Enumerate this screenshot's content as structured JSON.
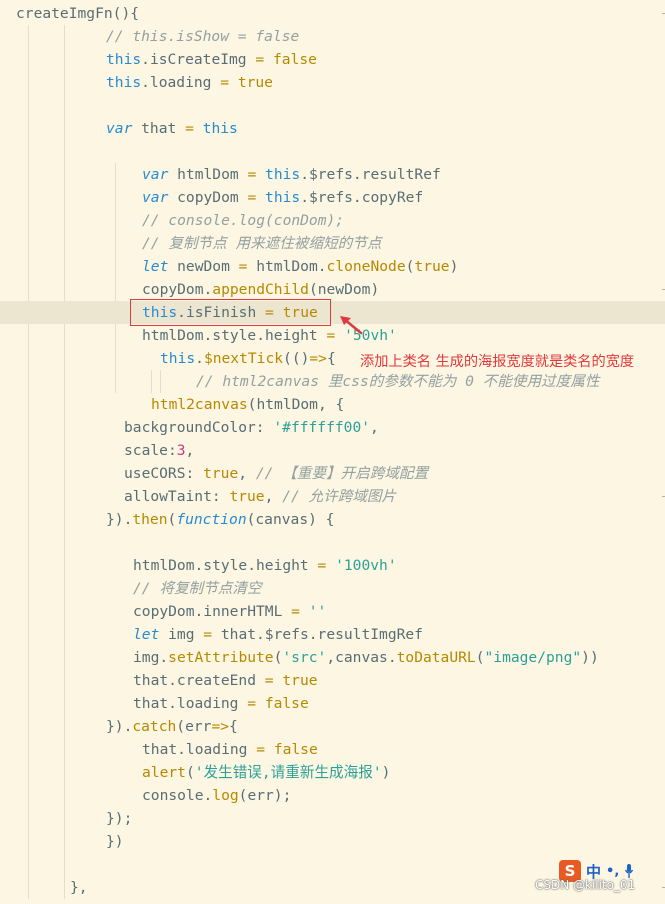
{
  "code_lines": [
    {
      "indent": 16,
      "tokens": [
        [
          "createImgFn",
          "def"
        ],
        [
          "(){",
          "def"
        ]
      ]
    },
    {
      "indent": 106,
      "tokens": [
        [
          "// this.isShow = false",
          "comment"
        ]
      ]
    },
    {
      "indent": 106,
      "tokens": [
        [
          "this",
          "kw"
        ],
        [
          ".isCreateImg ",
          "def"
        ],
        [
          "=",
          "eq"
        ],
        [
          " ",
          "def"
        ],
        [
          "false",
          "bool"
        ]
      ]
    },
    {
      "indent": 106,
      "tokens": [
        [
          "this",
          "kw"
        ],
        [
          ".loading ",
          "def"
        ],
        [
          "=",
          "eq"
        ],
        [
          " ",
          "def"
        ],
        [
          "true",
          "bool"
        ]
      ]
    },
    {
      "indent": 106,
      "tokens": []
    },
    {
      "indent": 106,
      "tokens": [
        [
          "var",
          "kwi"
        ],
        [
          " that ",
          "def"
        ],
        [
          "=",
          "eq"
        ],
        [
          " ",
          "def"
        ],
        [
          "this",
          "kw"
        ]
      ]
    },
    {
      "indent": 106,
      "tokens": []
    },
    {
      "indent": 142,
      "tokens": [
        [
          "var",
          "kwi"
        ],
        [
          " htmlDom ",
          "def"
        ],
        [
          "=",
          "eq"
        ],
        [
          " ",
          "def"
        ],
        [
          "this",
          "kw"
        ],
        [
          ".$refs.resultRef",
          "def"
        ]
      ]
    },
    {
      "indent": 142,
      "tokens": [
        [
          "var",
          "kwi"
        ],
        [
          " copyDom ",
          "def"
        ],
        [
          "=",
          "eq"
        ],
        [
          " ",
          "def"
        ],
        [
          "this",
          "kw"
        ],
        [
          ".$refs.copyRef",
          "def"
        ]
      ]
    },
    {
      "indent": 142,
      "tokens": [
        [
          "// console.log(conDom);",
          "comment"
        ]
      ]
    },
    {
      "indent": 142,
      "tokens": [
        [
          "// 复制节点 用来遮住被缩短的节点",
          "comment"
        ]
      ]
    },
    {
      "indent": 142,
      "tokens": [
        [
          "let",
          "kwi"
        ],
        [
          " newDom ",
          "def"
        ],
        [
          "=",
          "eq"
        ],
        [
          " htmlDom.",
          "def"
        ],
        [
          "cloneNode",
          "fn"
        ],
        [
          "(",
          "def"
        ],
        [
          "true",
          "bool"
        ],
        [
          ")",
          "def"
        ]
      ]
    },
    {
      "indent": 142,
      "tokens": [
        [
          "copyDom.",
          "def"
        ],
        [
          "appendChild",
          "fn"
        ],
        [
          "(newDom)",
          "def"
        ]
      ]
    },
    {
      "indent": 142,
      "tokens": [
        [
          "this",
          "kw"
        ],
        [
          ".isFinish ",
          "def"
        ],
        [
          "=",
          "eq"
        ],
        [
          " ",
          "def"
        ],
        [
          "true",
          "bool"
        ]
      ]
    },
    {
      "indent": 142,
      "tokens": [
        [
          "htmlDom.style.height ",
          "def"
        ],
        [
          "=",
          "eq"
        ],
        [
          " ",
          "def"
        ],
        [
          "'50vh'",
          "str"
        ]
      ]
    },
    {
      "indent": 160,
      "tokens": [
        [
          "this",
          "kw"
        ],
        [
          ".",
          "def"
        ],
        [
          "$nextTick",
          "fn"
        ],
        [
          "(()",
          "def"
        ],
        [
          "=>",
          "eq"
        ],
        [
          "{",
          "def"
        ]
      ]
    },
    {
      "indent": 196,
      "tokens": [
        [
          "// html2canvas 里css的参数不能为 0 不能使用过度属性",
          "comment"
        ]
      ]
    },
    {
      "indent": 151,
      "tokens": [
        [
          "html2canvas",
          "fn"
        ],
        [
          "(htmlDom, {",
          "def"
        ]
      ]
    },
    {
      "indent": 124,
      "tokens": [
        [
          "backgroundColor",
          "def"
        ],
        [
          ": ",
          "def"
        ],
        [
          "'#ffffff00'",
          "str"
        ],
        [
          ",",
          "def"
        ]
      ]
    },
    {
      "indent": 124,
      "tokens": [
        [
          "scale",
          "def"
        ],
        [
          ":",
          "def"
        ],
        [
          "3",
          "num"
        ],
        [
          ",",
          "def"
        ]
      ]
    },
    {
      "indent": 124,
      "tokens": [
        [
          "useCORS",
          "def"
        ],
        [
          ": ",
          "def"
        ],
        [
          "true",
          "bool"
        ],
        [
          ", ",
          "def"
        ],
        [
          "// 【重要】开启跨域配置",
          "comment"
        ]
      ]
    },
    {
      "indent": 124,
      "tokens": [
        [
          "allowTaint",
          "def"
        ],
        [
          ": ",
          "def"
        ],
        [
          "true",
          "bool"
        ],
        [
          ", ",
          "def"
        ],
        [
          "// 允许跨域图片",
          "comment"
        ]
      ]
    },
    {
      "indent": 106,
      "tokens": [
        [
          "}).",
          "def"
        ],
        [
          "then",
          "fn"
        ],
        [
          "(",
          "def"
        ],
        [
          "function",
          "kwi"
        ],
        [
          "(canvas) {",
          "def"
        ]
      ]
    },
    {
      "indent": 106,
      "tokens": []
    },
    {
      "indent": 133,
      "tokens": [
        [
          "htmlDom.style.height ",
          "def"
        ],
        [
          "=",
          "eq"
        ],
        [
          " ",
          "def"
        ],
        [
          "'100vh'",
          "str"
        ]
      ]
    },
    {
      "indent": 133,
      "tokens": [
        [
          "// 将复制节点清空",
          "comment"
        ]
      ]
    },
    {
      "indent": 133,
      "tokens": [
        [
          "copyDom.innerHTML ",
          "def"
        ],
        [
          "=",
          "eq"
        ],
        [
          " ",
          "def"
        ],
        [
          "''",
          "str"
        ]
      ]
    },
    {
      "indent": 133,
      "tokens": [
        [
          "let",
          "kwi"
        ],
        [
          " img ",
          "def"
        ],
        [
          "=",
          "eq"
        ],
        [
          " that.$refs.resultImgRef",
          "def"
        ]
      ]
    },
    {
      "indent": 133,
      "tokens": [
        [
          "img.",
          "def"
        ],
        [
          "setAttribute",
          "fn"
        ],
        [
          "(",
          "def"
        ],
        [
          "'src'",
          "str"
        ],
        [
          ",canvas.",
          "def"
        ],
        [
          "toDataURL",
          "fn"
        ],
        [
          "(",
          "def"
        ],
        [
          "\"image/png\"",
          "str"
        ],
        [
          "))",
          "def"
        ]
      ]
    },
    {
      "indent": 133,
      "tokens": [
        [
          "that.createEnd ",
          "def"
        ],
        [
          "=",
          "eq"
        ],
        [
          " ",
          "def"
        ],
        [
          "true",
          "bool"
        ]
      ]
    },
    {
      "indent": 133,
      "tokens": [
        [
          "that.loading ",
          "def"
        ],
        [
          "=",
          "eq"
        ],
        [
          " ",
          "def"
        ],
        [
          "false",
          "bool"
        ]
      ]
    },
    {
      "indent": 106,
      "tokens": [
        [
          "}).",
          "def"
        ],
        [
          "catch",
          "fn"
        ],
        [
          "(err",
          "def"
        ],
        [
          "=>",
          "eq"
        ],
        [
          "{",
          "def"
        ]
      ]
    },
    {
      "indent": 142,
      "tokens": [
        [
          "that.loading ",
          "def"
        ],
        [
          "=",
          "eq"
        ],
        [
          " ",
          "def"
        ],
        [
          "false",
          "bool"
        ]
      ]
    },
    {
      "indent": 142,
      "tokens": [
        [
          "alert",
          "fn"
        ],
        [
          "(",
          "def"
        ],
        [
          "'发生错误,请重新生成海报'",
          "str"
        ],
        [
          ")",
          "def"
        ]
      ]
    },
    {
      "indent": 142,
      "tokens": [
        [
          "console.",
          "def"
        ],
        [
          "log",
          "fn"
        ],
        [
          "(err);",
          "def"
        ]
      ]
    },
    {
      "indent": 106,
      "tokens": [
        [
          "});",
          "def"
        ]
      ]
    },
    {
      "indent": 106,
      "tokens": [
        [
          "})",
          "def"
        ]
      ]
    },
    {
      "indent": 106,
      "tokens": []
    },
    {
      "indent": 70,
      "tokens": [
        [
          "},",
          "def"
        ]
      ]
    }
  ],
  "highlighted_line": 13,
  "annotation": "添加上类名 生成的海报宽度就是类名的宽度",
  "watermark": "CSDN @kilito_01",
  "ime": {
    "logo": "S",
    "lang": "中",
    "punct": "•,"
  },
  "colors": {
    "background": "#fdf6e3",
    "annotation": "#e0393e",
    "highlight_row": "#ece6d1"
  }
}
